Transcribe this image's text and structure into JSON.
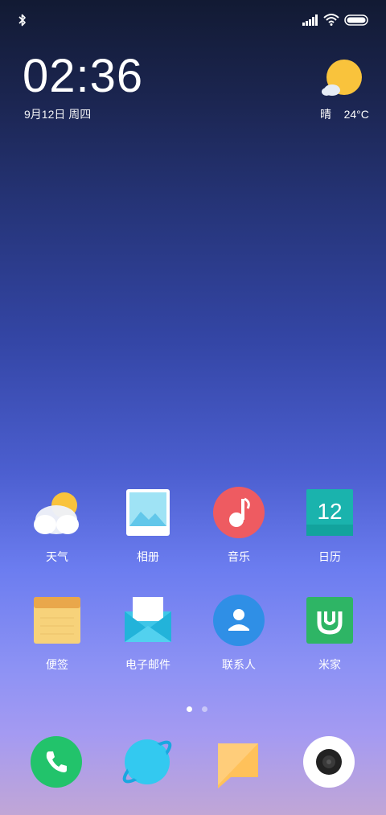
{
  "status": {
    "icons": [
      "bluetooth-icon",
      "signal-icon",
      "wifi-icon",
      "battery-icon"
    ]
  },
  "widget": {
    "time": "02:36",
    "date": "9月12日 周四",
    "weather_desc": "晴",
    "temperature": "24°C",
    "weather_icon": "sun-cloud-icon"
  },
  "apps": [
    {
      "label": "天气",
      "icon": "weather-icon"
    },
    {
      "label": "相册",
      "icon": "gallery-icon"
    },
    {
      "label": "音乐",
      "icon": "music-icon"
    },
    {
      "label": "日历",
      "icon": "calendar-icon",
      "day": "12"
    },
    {
      "label": "便签",
      "icon": "notes-icon"
    },
    {
      "label": "电子邮件",
      "icon": "email-icon"
    },
    {
      "label": "联系人",
      "icon": "contacts-icon"
    },
    {
      "label": "米家",
      "icon": "mi-home-icon"
    }
  ],
  "page_indicator": {
    "current": 1,
    "total": 2
  },
  "dock": [
    {
      "icon": "phone-icon"
    },
    {
      "icon": "browser-icon"
    },
    {
      "icon": "messages-icon"
    },
    {
      "icon": "camera-icon"
    }
  ],
  "colors": {
    "weather_sun": "#f9c33c",
    "music": "#ee5b61",
    "calendar": "#1ab3ad",
    "notes": "#f7d27a",
    "email": "#3fc6e8",
    "contacts": "#2f8fe6",
    "mi_home": "#2eb565",
    "phone": "#22c36b",
    "browser": "#33c9f0",
    "messages": "#ffc15a",
    "camera": "#ffffff"
  }
}
